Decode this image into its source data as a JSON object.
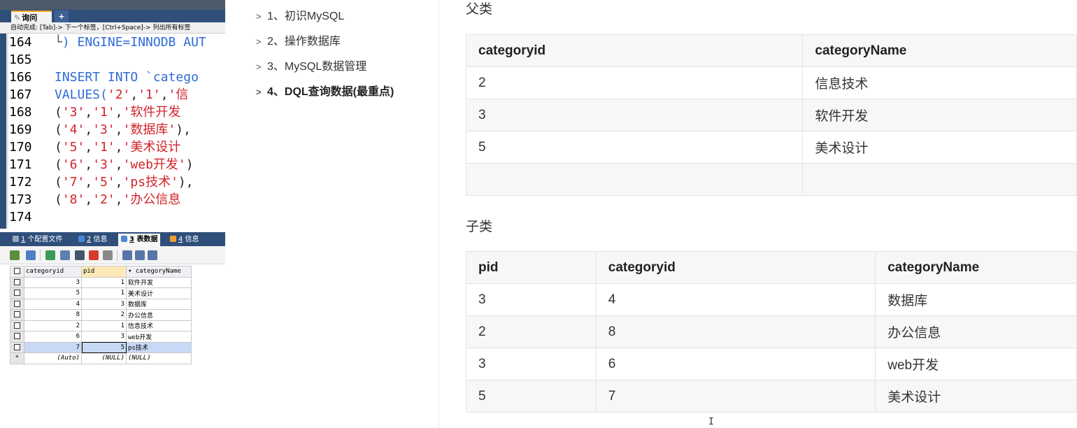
{
  "ide": {
    "query_tab": "询问",
    "query_tab_icon": "query-icon",
    "add_tab": "+",
    "hint": "自动完成: [Tab]-> 下一个标签，[Ctrl+Space]-> 列出所有标签",
    "lines": [
      {
        "n": "164",
        "parts": [
          {
            "t": "└",
            "c": "bracket"
          },
          {
            "t": ") ENGINE=INNODB AUT",
            "c": "kw"
          }
        ]
      },
      {
        "n": "165",
        "parts": []
      },
      {
        "n": "166",
        "parts": [
          {
            "t": "INSERT INTO `catego",
            "c": "kw"
          }
        ]
      },
      {
        "n": "167",
        "parts": [
          {
            "t": "VALUES(",
            "c": "kw"
          },
          {
            "t": "'2'",
            "c": "str"
          },
          {
            "t": ",",
            "c": "pun"
          },
          {
            "t": "'1'",
            "c": "str"
          },
          {
            "t": ",",
            "c": "pun"
          },
          {
            "t": "'信",
            "c": "str"
          }
        ]
      },
      {
        "n": "168",
        "parts": [
          {
            "t": "(",
            "c": "pun"
          },
          {
            "t": "'3'",
            "c": "str"
          },
          {
            "t": ",",
            "c": "pun"
          },
          {
            "t": "'1'",
            "c": "str"
          },
          {
            "t": ",",
            "c": "pun"
          },
          {
            "t": "'软件开发",
            "c": "str"
          }
        ]
      },
      {
        "n": "169",
        "parts": [
          {
            "t": "(",
            "c": "pun"
          },
          {
            "t": "'4'",
            "c": "str"
          },
          {
            "t": ",",
            "c": "pun"
          },
          {
            "t": "'3'",
            "c": "str"
          },
          {
            "t": ",",
            "c": "pun"
          },
          {
            "t": "'数据库'",
            "c": "str"
          },
          {
            "t": "),",
            "c": "pun"
          }
        ]
      },
      {
        "n": "170",
        "parts": [
          {
            "t": "(",
            "c": "pun"
          },
          {
            "t": "'5'",
            "c": "str"
          },
          {
            "t": ",",
            "c": "pun"
          },
          {
            "t": "'1'",
            "c": "str"
          },
          {
            "t": ",",
            "c": "pun"
          },
          {
            "t": "'美术设计",
            "c": "str"
          }
        ]
      },
      {
        "n": "171",
        "parts": [
          {
            "t": "(",
            "c": "pun"
          },
          {
            "t": "'6'",
            "c": "str"
          },
          {
            "t": ",",
            "c": "pun"
          },
          {
            "t": "'3'",
            "c": "str"
          },
          {
            "t": ",",
            "c": "pun"
          },
          {
            "t": "'web开发'",
            "c": "str"
          },
          {
            "t": ")",
            "c": "pun"
          }
        ]
      },
      {
        "n": "172",
        "parts": [
          {
            "t": "(",
            "c": "pun"
          },
          {
            "t": "'7'",
            "c": "str"
          },
          {
            "t": ",",
            "c": "pun"
          },
          {
            "t": "'5'",
            "c": "str"
          },
          {
            "t": ",",
            "c": "pun"
          },
          {
            "t": "'ps技术'",
            "c": "str"
          },
          {
            "t": "),",
            "c": "pun"
          }
        ]
      },
      {
        "n": "173",
        "parts": [
          {
            "t": "(",
            "c": "pun"
          },
          {
            "t": "'8'",
            "c": "str"
          },
          {
            "t": ",",
            "c": "pun"
          },
          {
            "t": "'2'",
            "c": "str"
          },
          {
            "t": ",",
            "c": "pun"
          },
          {
            "t": "'办公信息",
            "c": "str"
          }
        ]
      },
      {
        "n": "174",
        "parts": []
      }
    ],
    "bottom_tabs": [
      {
        "num": "1",
        "label": " 个配置文件",
        "active": false,
        "icon_color": "#9aa8b8"
      },
      {
        "num": "2",
        "label": " 信息",
        "active": false,
        "icon_color": "#4b86d8"
      },
      {
        "num": "3",
        "label": " 表数据",
        "active": true,
        "icon_color": "#4b86d8"
      },
      {
        "num": "4",
        "label": " 信息",
        "active": false,
        "icon_color": "#f0a030"
      }
    ],
    "toolbar_icons": [
      "grid-mode-icon",
      "export-icon",
      "insert-row-icon",
      "duplicate-row-icon",
      "save-icon",
      "delete-row-icon",
      "cancel-icon",
      "grid-view-icon",
      "form-view-icon",
      "text-view-icon"
    ],
    "grid": {
      "headers": [
        "categoryid",
        "pid",
        "▾ categoryName"
      ],
      "rows": [
        [
          "3",
          "1",
          "软件开发"
        ],
        [
          "5",
          "1",
          "美术设计"
        ],
        [
          "4",
          "3",
          "数据库"
        ],
        [
          "8",
          "2",
          "办公信息"
        ],
        [
          "2",
          "1",
          "信息技术"
        ],
        [
          "6",
          "3",
          "web开发"
        ],
        [
          "7",
          "5",
          "ps技术"
        ]
      ],
      "selected_row": 6,
      "new_row_marker": "*",
      "new_row": [
        "(Auto)",
        "(NULL)",
        "(NULL)"
      ]
    }
  },
  "toc": {
    "items": [
      {
        "label": "1、初识MySQL",
        "active": false
      },
      {
        "label": "2、操作数据库",
        "active": false
      },
      {
        "label": "3、MySQL数据管理",
        "active": false
      },
      {
        "label": "4、DQL查询数据(最重点)",
        "active": true
      }
    ],
    "chevron": ">"
  },
  "content": {
    "parent_label": "父类",
    "parent_table": {
      "headers": [
        "categoryid",
        "categoryName"
      ],
      "rows": [
        [
          "2",
          "信息技术"
        ],
        [
          "3",
          "软件开发"
        ],
        [
          "5",
          "美术设计"
        ],
        [
          "",
          ""
        ]
      ]
    },
    "child_label": "子类",
    "child_table": {
      "headers": [
        "pid",
        "categoryid",
        "categoryName"
      ],
      "rows": [
        [
          "3",
          "4",
          "数据库"
        ],
        [
          "2",
          "8",
          "办公信息"
        ],
        [
          "3",
          "6",
          "web开发"
        ],
        [
          "5",
          "7",
          "美术设计"
        ]
      ]
    },
    "caret": "I"
  }
}
